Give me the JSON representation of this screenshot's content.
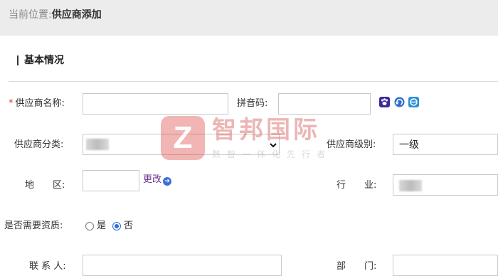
{
  "breadcrumb": {
    "prefix": "当前位置:",
    "current": "供应商添加"
  },
  "section": {
    "title": "基本情况"
  },
  "fields": {
    "supplier_name": {
      "required_mark": "*",
      "label": "供应商名称:",
      "value": ""
    },
    "pinyin": {
      "label": "拼音码:",
      "value": "",
      "icons": [
        "paw-icon",
        "refresh-icon",
        "e-icon"
      ]
    },
    "category": {
      "label": "供应商分类:"
    },
    "level": {
      "label": "供应商级别:",
      "value": "一级"
    },
    "region": {
      "label": "地　　区:",
      "value": "",
      "change_link": "更改"
    },
    "industry": {
      "label": "行　　业:"
    },
    "qualification": {
      "label": "是否需要资质:",
      "options": [
        "是",
        "否"
      ],
      "selected": "否"
    },
    "contact": {
      "label": "联 系 人:",
      "value": ""
    },
    "department": {
      "label": "部　　门:",
      "value": ""
    }
  },
  "watermark": {
    "title": "智邦国际",
    "subtitle": "数智一体化先行者"
  },
  "colors": {
    "required": "#e0302a",
    "link": "#6a2f8a",
    "radio_selected": "#2f6fd8",
    "topbar": "#ececec"
  }
}
